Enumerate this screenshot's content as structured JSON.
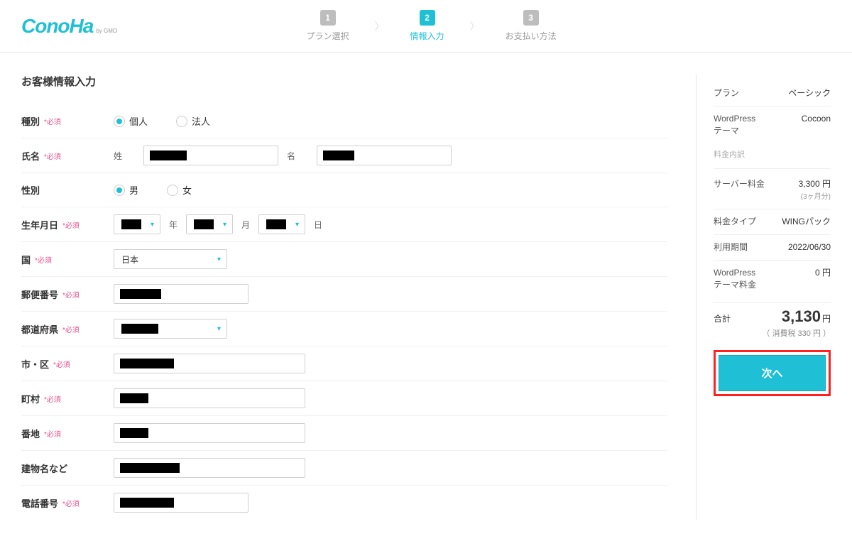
{
  "logo": {
    "main": "ConoHa",
    "sub": "by GMO"
  },
  "steps": {
    "s1": {
      "num": "1",
      "label": "プラン選択"
    },
    "s2": {
      "num": "2",
      "label": "情報入力"
    },
    "s3": {
      "num": "3",
      "label": "お支払い方法"
    }
  },
  "section_title": "お客様情報入力",
  "required": "*必須",
  "labels": {
    "type": "種別",
    "name": "氏名",
    "gender": "性別",
    "birth": "生年月日",
    "country": "国",
    "postal": "郵便番号",
    "pref": "都道府県",
    "city": "市・区",
    "town": "町村",
    "street": "番地",
    "building": "建物名など",
    "phone": "電話番号"
  },
  "radios": {
    "personal": "個人",
    "corporate": "法人",
    "male": "男",
    "female": "女"
  },
  "sublabels": {
    "sei": "姓",
    "mei": "名",
    "year": "年",
    "month": "月",
    "day": "日"
  },
  "country_select": "日本",
  "sidebar": {
    "plan_l": "プラン",
    "plan_v": "ベーシック",
    "theme_l": "WordPress\nテーマ",
    "theme_v": "Cocoon",
    "detail_h": "料金内訳",
    "server_l": "サーバー料金",
    "server_v": "3,300 円",
    "server_sub": "(3ヶ月分)",
    "feetype_l": "料金タイプ",
    "feetype_v": "WINGパック",
    "period_l": "利用期間",
    "period_v": "2022/06/30",
    "wpfee_l": "WordPress\nテーマ料金",
    "wpfee_v": "0 円",
    "total_l": "合計",
    "total_v": "3,130",
    "total_unit": "円",
    "tax": "（ 消費税 330 円 ）"
  },
  "next_button": "次へ"
}
